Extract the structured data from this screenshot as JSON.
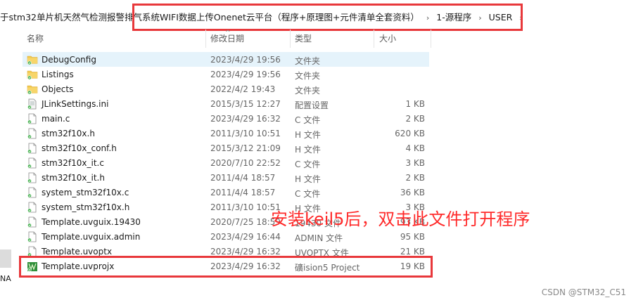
{
  "breadcrumb": {
    "segments": [
      "于stm32单片机天然气检测报警排气系统WIFI数据上传Onenet云平台（程序+原理图+元件清单全套资料）",
      "1-源程序",
      "USER"
    ],
    "separator": "›"
  },
  "columns": {
    "name": "名称",
    "date": "修改日期",
    "type": "类型",
    "size": "大小"
  },
  "files": [
    {
      "name": "DebugConfig",
      "date": "2023/4/29 19:56",
      "type": "文件夹",
      "size": "",
      "icon": "folder-icon"
    },
    {
      "name": "Listings",
      "date": "2023/4/29 19:56",
      "type": "文件夹",
      "size": "",
      "icon": "folder-icon"
    },
    {
      "name": "Objects",
      "date": "2022/4/2 19:43",
      "type": "文件夹",
      "size": "",
      "icon": "folder-icon"
    },
    {
      "name": "JLinkSettings.ini",
      "date": "2015/3/15 12:27",
      "type": "配置设置",
      "size": "1 KB",
      "icon": "settings-file-icon"
    },
    {
      "name": "main.c",
      "date": "2023/4/29 16:32",
      "type": "C 文件",
      "size": "2 KB",
      "icon": "file-icon"
    },
    {
      "name": "stm32f10x.h",
      "date": "2011/3/10 10:51",
      "type": "H 文件",
      "size": "620 KB",
      "icon": "file-icon"
    },
    {
      "name": "stm32f10x_conf.h",
      "date": "2015/3/12 21:09",
      "type": "H 文件",
      "size": "4 KB",
      "icon": "file-icon"
    },
    {
      "name": "stm32f10x_it.c",
      "date": "2020/7/10 22:52",
      "type": "C 文件",
      "size": "3 KB",
      "icon": "file-icon"
    },
    {
      "name": "stm32f10x_it.h",
      "date": "2011/4/4 18:57",
      "type": "H 文件",
      "size": "2 KB",
      "icon": "file-icon"
    },
    {
      "name": "system_stm32f10x.c",
      "date": "2011/4/4 18:57",
      "type": "C 文件",
      "size": "36 KB",
      "icon": "file-icon"
    },
    {
      "name": "system_stm32f10x.h",
      "date": "2011/3/10 10:51",
      "type": "H 文件",
      "size": "3 KB",
      "icon": "file-icon"
    },
    {
      "name": "Template.uvguix.19430",
      "date": "2020/7/25 18:59",
      "type": "19430 文件",
      "size": "93 KB",
      "icon": "file-icon"
    },
    {
      "name": "Template.uvguix.admin",
      "date": "2023/4/29 16:44",
      "type": "ADMIN 文件",
      "size": "95 KB",
      "icon": "file-icon"
    },
    {
      "name": "Template.uvoptx",
      "date": "2023/4/29 16:32",
      "type": "UVOPTX 文件",
      "size": "21 KB",
      "icon": "file-icon"
    },
    {
      "name": "Template.uvprojx",
      "date": "2023/4/29 16:32",
      "type": "礦ision5 Project",
      "size": "19 KB",
      "icon": "keil-project-icon"
    }
  ],
  "annotation": "安装keil5后，双击此文件打开程序",
  "left_edge_text": "NA",
  "watermark": "CSDN @STM32_C51",
  "colors": {
    "highlight": "#e8383b",
    "annotation": "#ff2a2a",
    "selected_row": "#e5f3fb",
    "folder": "#f2c94c"
  }
}
